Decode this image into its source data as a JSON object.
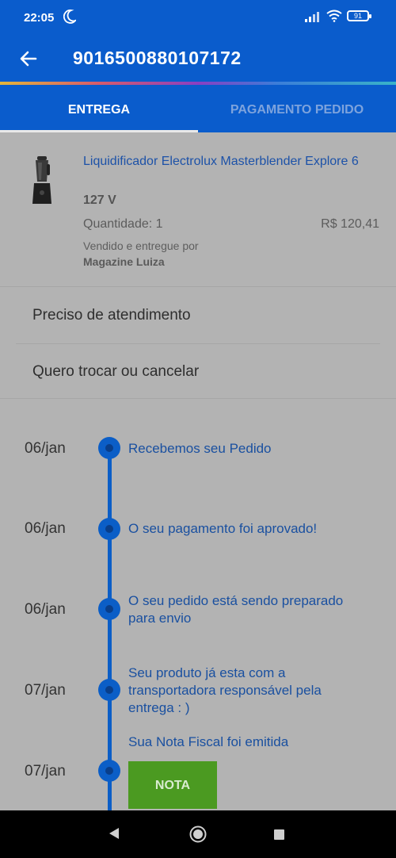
{
  "status_bar": {
    "time": "22:05",
    "battery": "91",
    "icons": [
      "moon-icon",
      "signal-icon",
      "wifi-icon",
      "battery-icon"
    ]
  },
  "app_bar": {
    "title": "9016500880107172",
    "back_icon": "arrow-left-icon"
  },
  "tabs": [
    {
      "label": "ENTREGA",
      "active": true
    },
    {
      "label": "PAGAMENTO PEDIDO",
      "active": false
    }
  ],
  "product": {
    "name": "Liquidificador Electrolux Masterblender Explore 6",
    "variant": "127 V",
    "quantity": "Quantidade: 1",
    "price": "R$ 120,41",
    "sold_by_label": "Vendido e entregue por",
    "seller": "Magazine Luiza"
  },
  "menu": {
    "support": "Preciso de atendimento",
    "exchange": "Quero trocar ou cancelar"
  },
  "timeline": [
    {
      "date": "06/jan",
      "text": "Recebemos seu Pedido"
    },
    {
      "date": "06/jan",
      "text": "O seu pagamento foi aprovado!"
    },
    {
      "date": "06/jan",
      "text": "O seu pedido está sendo preparado para envio"
    },
    {
      "date": "07/jan",
      "text": "Seu produto já esta com a transportadora responsável pela entrega : )"
    },
    {
      "date": "07/jan",
      "text": "Sua Nota Fiscal foi emitida",
      "button": "NOTA"
    }
  ],
  "colors": {
    "primary": "#0a5ccc",
    "link_text": "#1d52a8",
    "timeline": "#0b5ec7",
    "nota_button": "#4b9a21",
    "background": "#b3b3b3"
  }
}
